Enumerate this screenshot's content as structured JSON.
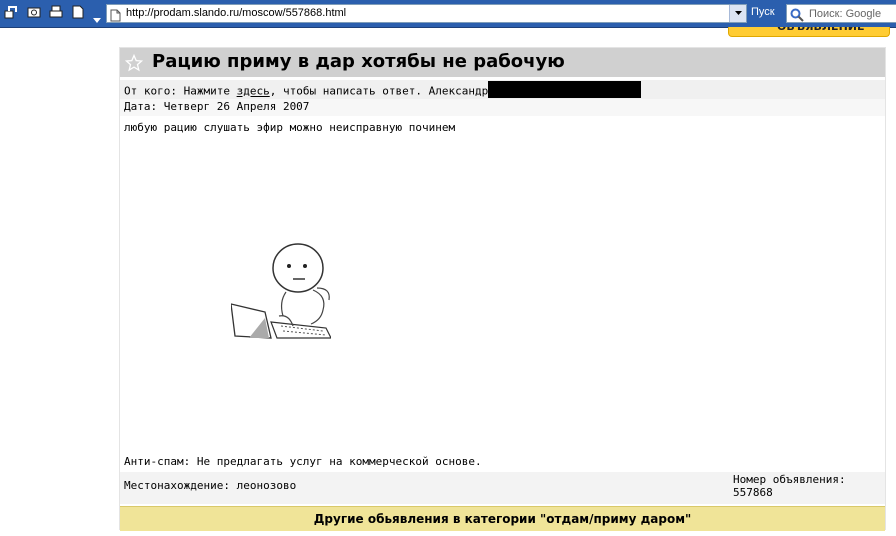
{
  "browser": {
    "url": "http://prodam.slando.ru/moscow/557868.html",
    "go_label": "Пуск",
    "search_placeholder": "Поиск: Google"
  },
  "ad": {
    "title": "Рацию приму в дар хотябы не рабочую",
    "from_prefix": "От кого: Нажмите ",
    "from_link": "здесь",
    "from_suffix": ", чтобы написать ответ. Александр",
    "date": "Дата: Четверг 26 Апреля 2007",
    "body": "любую рацию слушать эфир можно неисправную починем",
    "antispam": "Анти-спам: Не предлагать услуг на коммерческой основе.",
    "location": "Местонахождение: леонозово",
    "ad_number_label": "Номер объявления:",
    "ad_number": "557868",
    "footer_link": "Другие обьявления в категории \"отдам/приму даром\""
  },
  "colors": {
    "toolbar_bg": "#2b5fae",
    "title_bar_bg": "#d0d0d0",
    "footer_bg": "#f0e498",
    "yellow_tab": "#ffcc33"
  }
}
